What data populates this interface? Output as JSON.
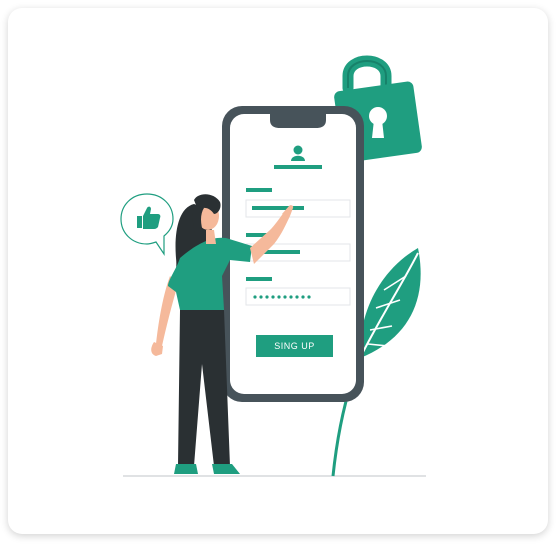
{
  "illustration": {
    "button_label": "SING UP",
    "password_mask": "••••••••••",
    "accent_color": "#1f9e80",
    "dark_color": "#2a3033",
    "skin_color": "#f5b99b"
  }
}
